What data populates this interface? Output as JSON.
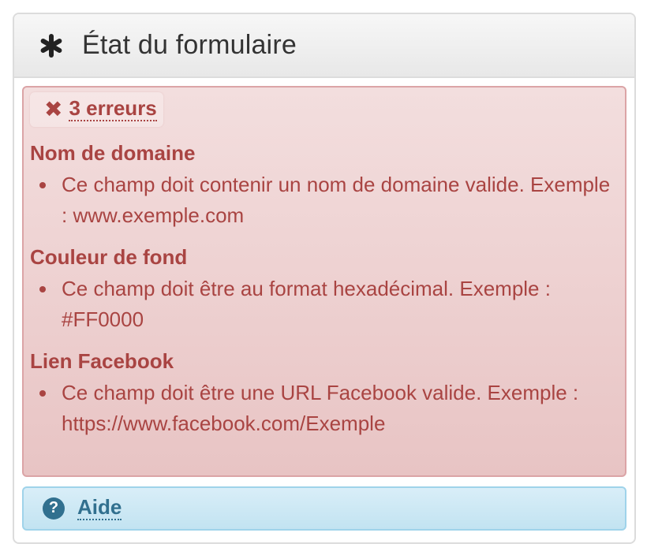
{
  "panel": {
    "title": "État du formulaire",
    "title_icon": "asterisk-icon"
  },
  "errors": {
    "icon": "close-icon",
    "count_label": "3 erreurs",
    "fields": [
      {
        "name": "Nom de domaine",
        "messages": [
          "Ce champ doit contenir un nom de domaine valide. Exemple : www.exemple.com"
        ]
      },
      {
        "name": "Couleur de fond",
        "messages": [
          "Ce champ doit être au format hexadécimal. Exemple : #FF0000"
        ]
      },
      {
        "name": "Lien Facebook",
        "messages": [
          "Ce champ doit être une URL Facebook valide. Exemple : https://www.facebook.com/Exemple"
        ]
      }
    ]
  },
  "help": {
    "icon": "question-circle-icon",
    "label": "Aide"
  },
  "colors": {
    "danger_text": "#a94442",
    "danger_bg": "#f2dede",
    "info_text": "#31708f",
    "info_bg": "#d9edf7"
  }
}
